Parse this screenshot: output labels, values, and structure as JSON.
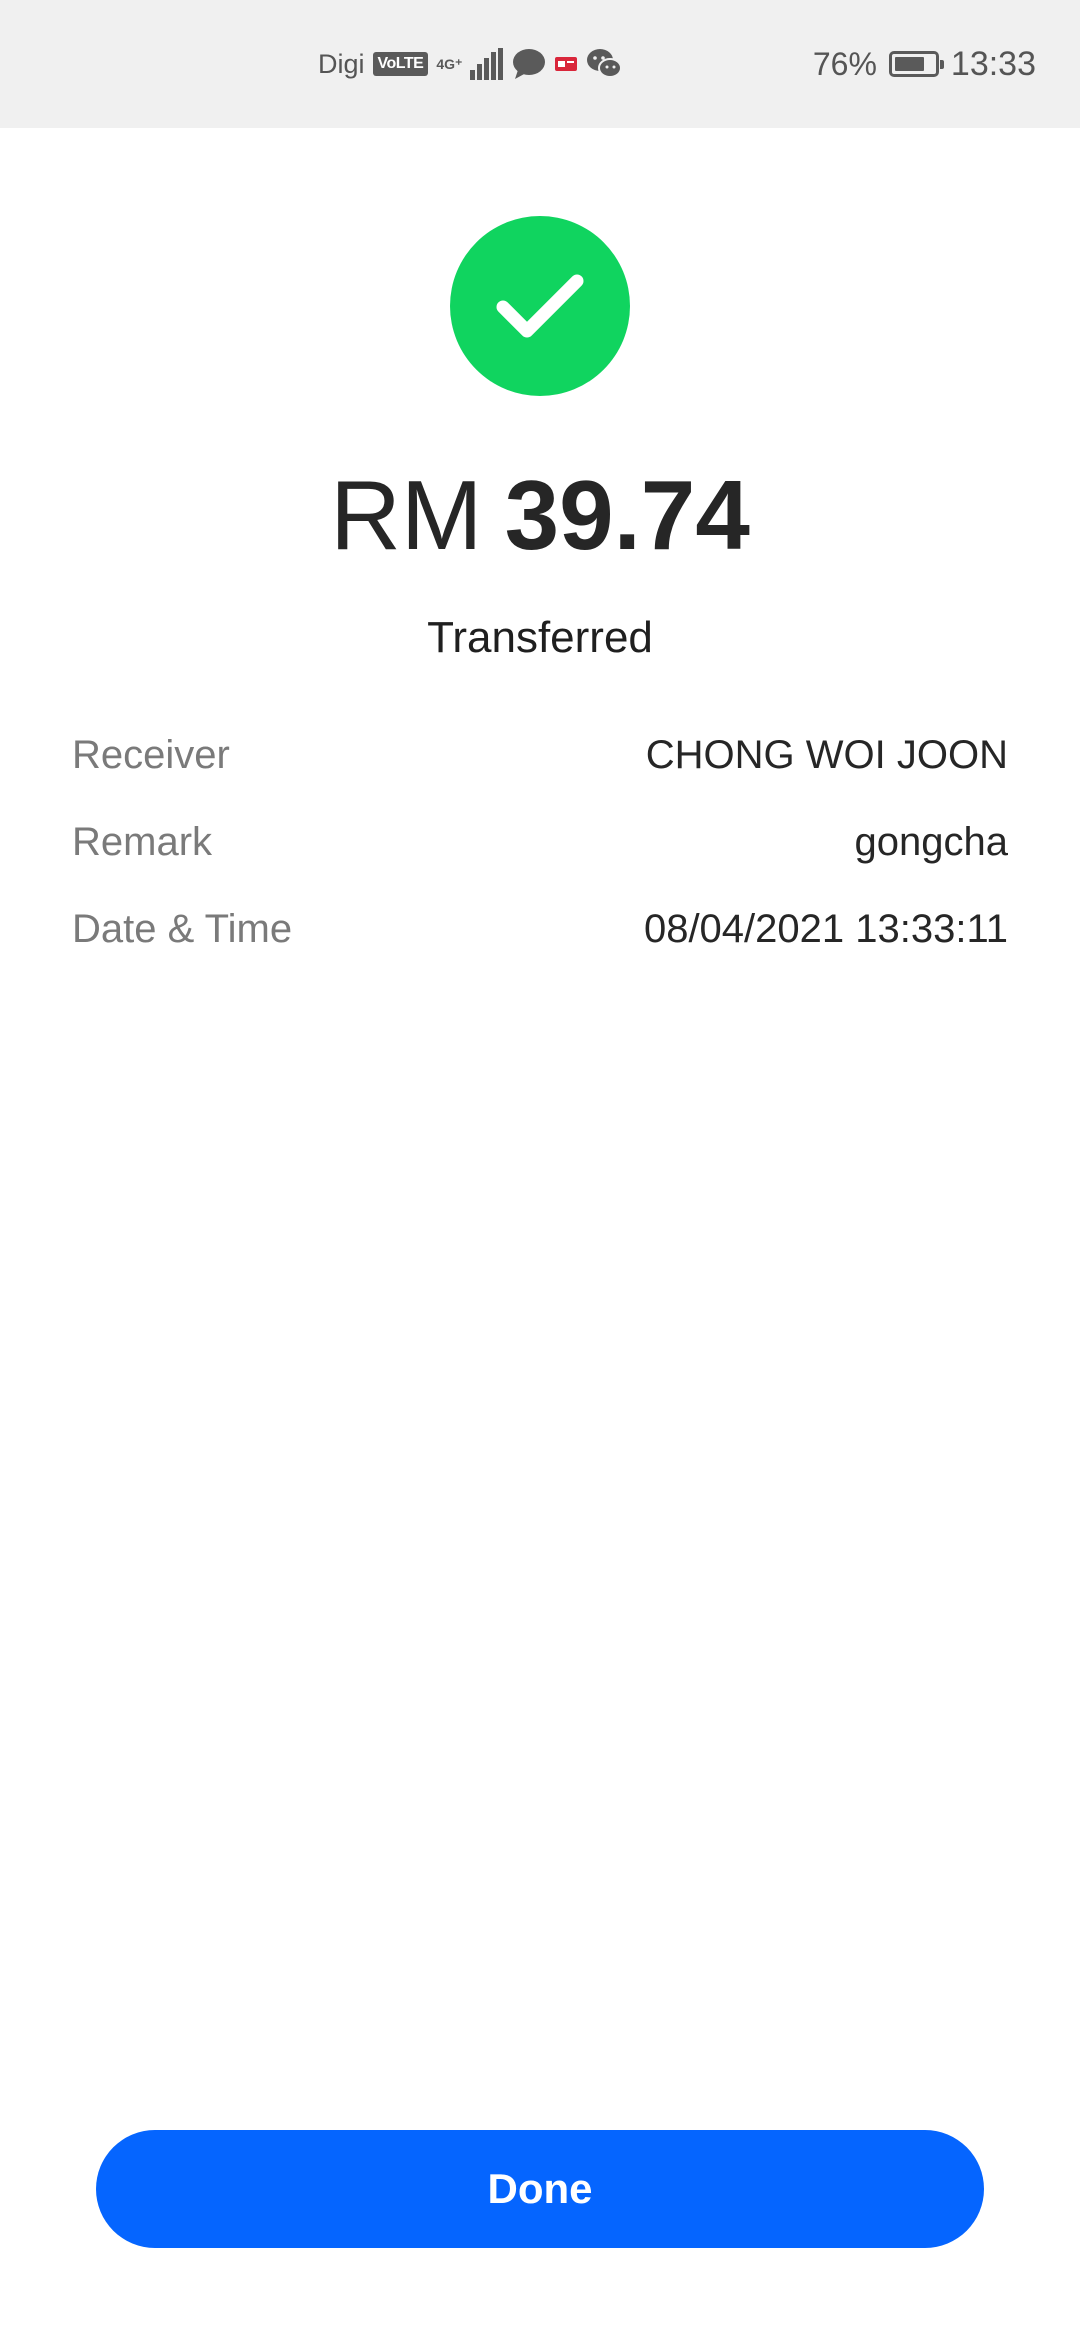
{
  "status_bar": {
    "carrier": "Digi",
    "volte": "VoLTE",
    "network": "4G⁺",
    "battery_percent": "76%",
    "battery_level": 0.76,
    "time": "13:33"
  },
  "transaction": {
    "currency": "RM",
    "amount": "39.74",
    "status": "Transferred",
    "details": [
      {
        "label": "Receiver",
        "value": "CHONG WOI JOON"
      },
      {
        "label": "Remark",
        "value": "gongcha"
      },
      {
        "label": "Date & Time",
        "value": "08/04/2021 13:33:11"
      }
    ]
  },
  "actions": {
    "done_label": "Done"
  },
  "colors": {
    "success": "#10d45f",
    "primary": "#0565ff"
  },
  "icons": [
    "signal-icon",
    "message-icon",
    "sim-icon",
    "wechat-icon",
    "battery-icon",
    "checkmark-icon"
  ]
}
